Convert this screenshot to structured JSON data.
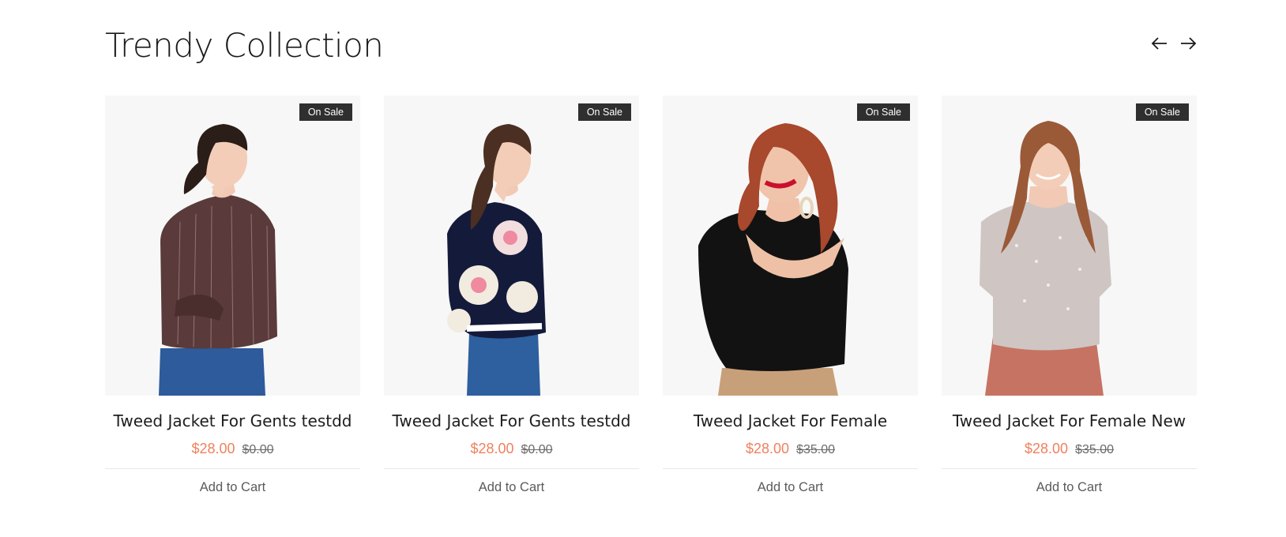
{
  "section": {
    "title": "Trendy Collection",
    "prev_icon": "arrow-left-icon",
    "next_icon": "arrow-right-icon"
  },
  "colors": {
    "accent_price": "#f0805d",
    "badge_bg": "#2f2f2f",
    "card_bg": "#f7f7f7"
  },
  "products": [
    {
      "name": "Tweed Jacket For Gents testdd",
      "badge": "On Sale",
      "price": "$28.00",
      "old_price": "$0.00",
      "cta": "Add to Cart",
      "image": "woman-brown-striped-shirt-photo"
    },
    {
      "name": "Tweed Jacket For Gents testdd",
      "badge": "On Sale",
      "price": "$28.00",
      "old_price": "$0.00",
      "cta": "Add to Cart",
      "image": "woman-floral-navy-top-photo"
    },
    {
      "name": "Tweed Jacket For Female",
      "badge": "On Sale",
      "price": "$28.00",
      "old_price": "$35.00",
      "cta": "Add to Cart",
      "image": "woman-black-blouse-photo"
    },
    {
      "name": "Tweed Jacket For Female New",
      "badge": "On Sale",
      "price": "$28.00",
      "old_price": "$35.00",
      "cta": "Add to Cart",
      "image": "woman-sequin-top-photo"
    }
  ]
}
